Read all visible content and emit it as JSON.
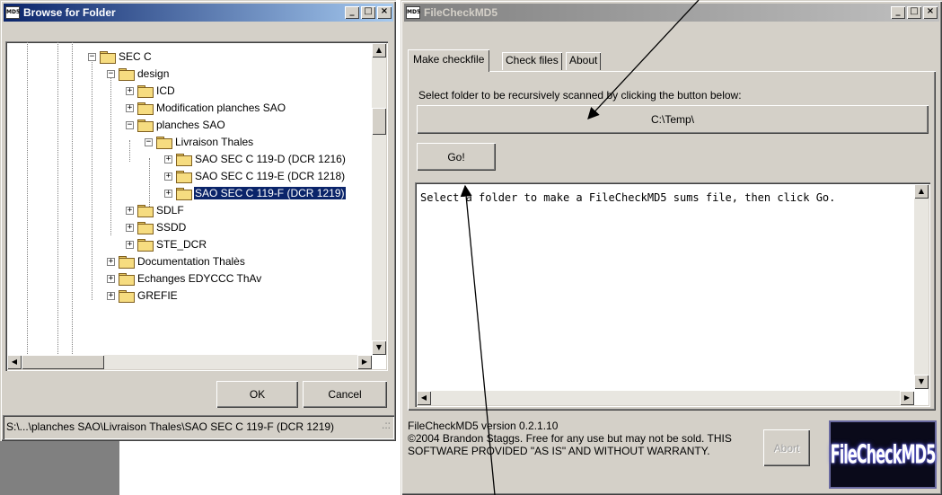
{
  "browse_dialog": {
    "title": "Browse for Folder",
    "tree": [
      {
        "label": "SEC C",
        "expander": "−"
      },
      {
        "label": "design",
        "expander": "−"
      },
      {
        "label": "ICD",
        "expander": "+"
      },
      {
        "label": "Modification planches SAO",
        "expander": "+"
      },
      {
        "label": "planches SAO",
        "expander": "−"
      },
      {
        "label": "Livraison Thales",
        "expander": "−"
      },
      {
        "label": "SAO SEC C 119-D (DCR 1216)",
        "expander": "+"
      },
      {
        "label": "SAO SEC C 119-E (DCR 1218)",
        "expander": "+"
      },
      {
        "label": "SAO SEC C 119-F (DCR 1219)",
        "expander": "+",
        "selected": true
      },
      {
        "label": "SDLF",
        "expander": "+"
      },
      {
        "label": "SSDD",
        "expander": "+"
      },
      {
        "label": "STE_DCR",
        "expander": "+"
      },
      {
        "label": "Documentation Thalès",
        "expander": "+"
      },
      {
        "label": "Echanges EDYCCC ThAv",
        "expander": "+"
      },
      {
        "label": "GREFIE",
        "expander": "+"
      }
    ],
    "ok_label": "OK",
    "cancel_label": "Cancel",
    "status_path": "S:\\...\\planches SAO\\Livraison Thales\\SAO SEC C 119-F (DCR 1219)"
  },
  "filecheck": {
    "title": "FileCheckMD5",
    "tabs": [
      "Make checkfile",
      "Check files",
      "About"
    ],
    "instruction": "Select folder to be recursively scanned by clicking the button below:",
    "folder_button": "C:\\Temp\\",
    "go_label": "Go!",
    "output_text": "Select a folder to make a FileCheckMD5 sums file, then click Go.",
    "version_line": "FileCheckMD5 version 0.2.1.10",
    "copyright": "©2004 Brandon Staggs. Free for any use but may not be sold. THIS SOFTWARE PROVIDED \"AS IS\" AND WITHOUT WARRANTY.",
    "abort_label": "Abort",
    "logo_text": "FileCheckMD5"
  },
  "icons": {
    "app_icon": "md5-app-icon",
    "minimize": "minimize-icon",
    "maximize": "maximize-icon",
    "close": "close-icon"
  }
}
